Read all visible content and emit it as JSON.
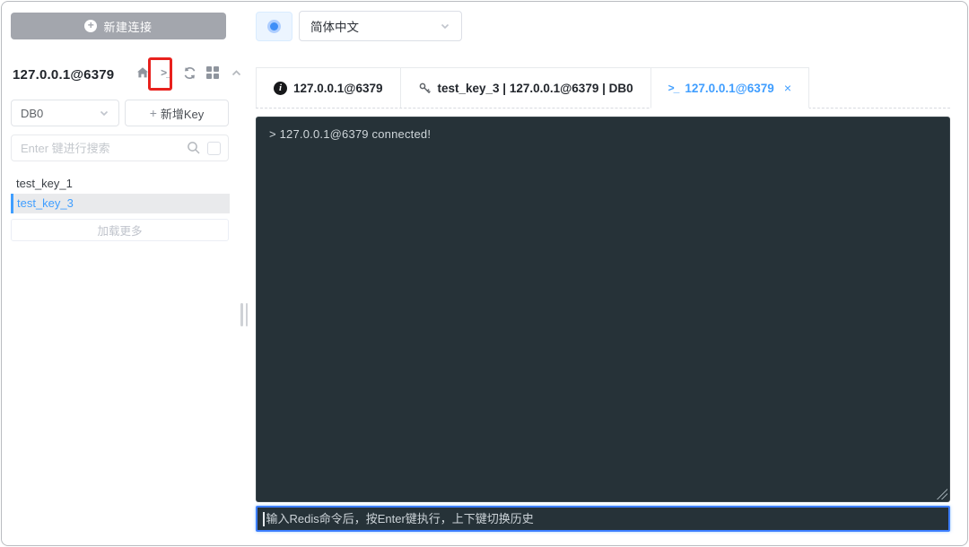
{
  "theme": {
    "accent": "#409EFF",
    "terminal_bg": "#263238",
    "annotation_red": "#e8211d",
    "new_connection_button_gray": "#a3a6ad",
    "selected_key_bg": "#e9eaec"
  },
  "glyphs": {
    "plus": "+",
    "terminal": ">_",
    "close": "×",
    "info": "i"
  },
  "sidebar": {
    "new_connection": {
      "label": "新建连接"
    },
    "connection": {
      "name": "127.0.0.1@6379"
    },
    "db_select": {
      "value": "DB0"
    },
    "add_key": {
      "label": "新增Key"
    },
    "search": {
      "placeholder": "Enter 键进行搜索"
    },
    "keys": [
      {
        "name": "test_key_1",
        "selected": false
      },
      {
        "name": "test_key_3",
        "selected": true
      }
    ],
    "load_more": {
      "label": "加载更多"
    }
  },
  "topbar": {
    "language_select": {
      "value": "简体中文"
    }
  },
  "tabs": [
    {
      "icon": "info-icon",
      "label": "127.0.0.1@6379",
      "active": false
    },
    {
      "icon": "key-icon",
      "label": "test_key_3 | 127.0.0.1@6379 | DB0",
      "active": false
    },
    {
      "icon": "terminal-icon",
      "label": "127.0.0.1@6379",
      "active": true,
      "closable": true
    }
  ],
  "terminal": {
    "output_lines": [
      "> 127.0.0.1@6379 connected!"
    ],
    "command_input": {
      "value": "",
      "placeholder": "输入Redis命令后，按Enter键执行，上下键切换历史"
    }
  },
  "annotation": {
    "shape": "red-box",
    "target": "terminal-icon"
  }
}
